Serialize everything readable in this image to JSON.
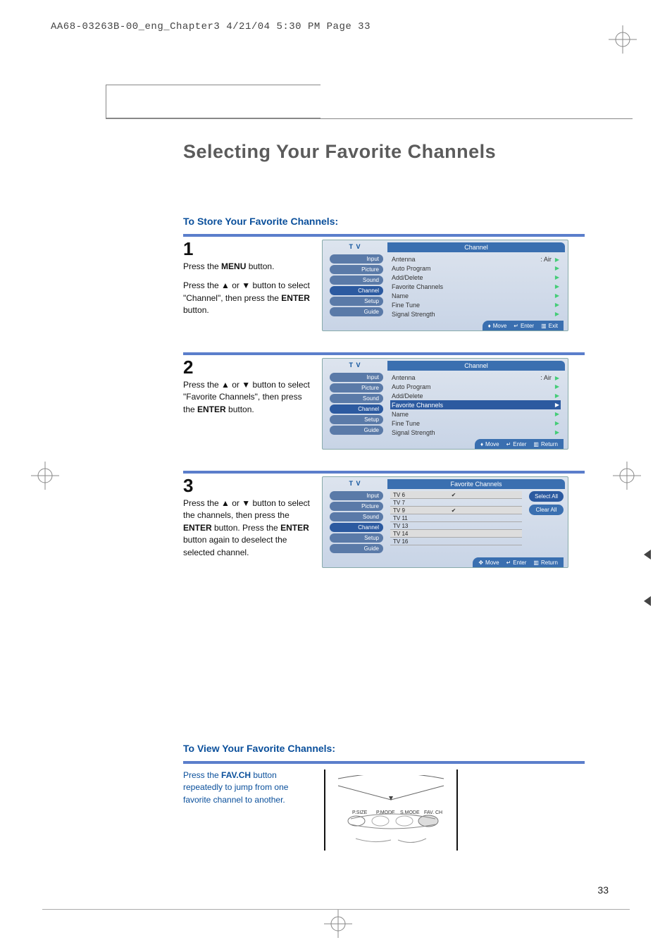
{
  "runhead": "AA68-03263B-00_eng_Chapter3  4/21/04  5:30 PM  Page 33",
  "title": "Selecting Your Favorite Channels",
  "sub_store": "To Store Your Favorite Channels:",
  "sub_view": "To View Your Favorite Channels:",
  "step1": {
    "num": "1",
    "p1a": "Press the ",
    "p1b": "MENU",
    "p1c": " button.",
    "p2a": "Press the ▲ or ▼ button to select \"Channel\", then press the ",
    "p2b": "ENTER",
    "p2c": " button."
  },
  "step2": {
    "num": "2",
    "p1a": "Press the ▲ or ▼ button to select \"Favorite Channels\", then press the ",
    "p1b": "ENTER",
    "p1c": " button."
  },
  "step3": {
    "num": "3",
    "p1a": "Press the ▲ or ▼ button to select the channels, then press the ",
    "p1b": "ENTER",
    "p1c": " button. Press the ",
    "p1d": "ENTER",
    "p1e": " button again to deselect the selected channel."
  },
  "view": {
    "a": "Press the ",
    "b": "FAV.CH",
    "c": " button repeatedly to jump from one favorite channel to another."
  },
  "osd": {
    "tv": "T V",
    "title_channel": "Channel",
    "title_fav": "Favorite Channels",
    "side": [
      "Input",
      "Picture",
      "Sound",
      "Channel",
      "Setup",
      "Guide"
    ],
    "rows": [
      {
        "l": "Antenna",
        "r": ": Air"
      },
      {
        "l": "Auto Program",
        "r": ""
      },
      {
        "l": "Add/Delete",
        "r": ""
      },
      {
        "l": "Favorite Channels",
        "r": ""
      },
      {
        "l": "Name",
        "r": ""
      },
      {
        "l": "Fine Tune",
        "r": ""
      },
      {
        "l": "Signal Strength",
        "r": ""
      }
    ],
    "fav_rows": [
      "TV 6",
      "TV 7",
      "TV 9",
      "TV 11",
      "TV 13",
      "TV 14",
      "TV 16"
    ],
    "btn_sel": "Select All",
    "btn_clr": "Clear All",
    "foot_move": "Move",
    "foot_enter": "Enter",
    "foot_exit": "Exit",
    "foot_return": "Return"
  },
  "remote_labels": [
    "P.SIZE",
    "P.MODE",
    "S.MODE",
    "FAV. CH"
  ],
  "pagenum": "33"
}
